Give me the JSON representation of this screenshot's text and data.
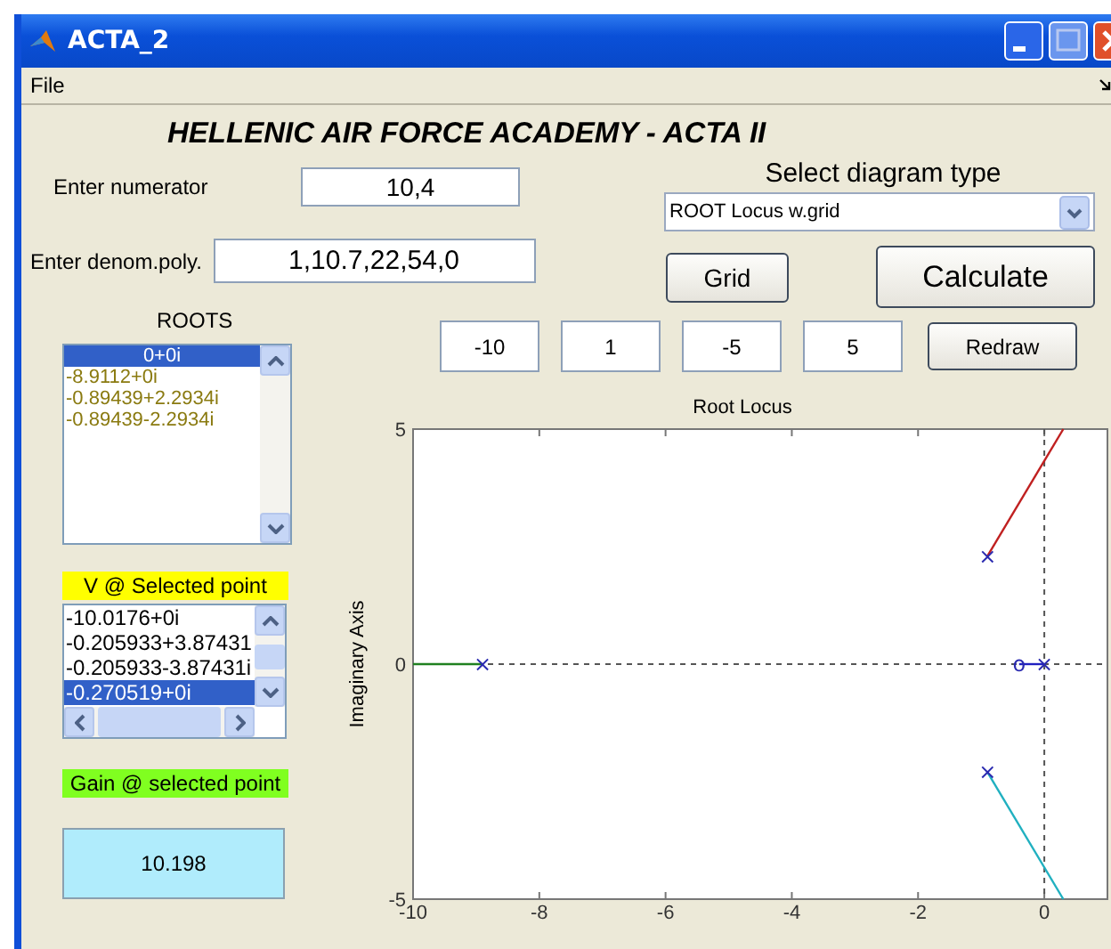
{
  "window": {
    "title": "ACTA_2"
  },
  "menu": [
    "File"
  ],
  "heading": "HELLENIC AIR FORCE ACADEMY - ACTA II",
  "numerator": {
    "label": "Enter numerator",
    "value": "10,4"
  },
  "denominator": {
    "label": "Enter denom.poly.",
    "value": "1,10.7,22,54,0"
  },
  "diagram_type": {
    "label": "Select diagram type",
    "value": "ROOT Locus w.grid"
  },
  "buttons": {
    "grid": "Grid",
    "calculate": "Calculate",
    "redraw": "Redraw"
  },
  "roots": {
    "label": "ROOTS",
    "items": [
      {
        "text": "0+0i",
        "selected": true
      },
      {
        "text": "-8.9112+0i",
        "selected": false
      },
      {
        "text": "-0.89439+2.2934i",
        "selected": false
      },
      {
        "text": "-0.89439-2.2934i",
        "selected": false
      }
    ]
  },
  "selected_point": {
    "label": "V @ Selected point",
    "items": [
      {
        "text": "-10.0176+0i",
        "selected": false
      },
      {
        "text": "-0.205933+3.87431",
        "selected": false
      },
      {
        "text": "-0.205933-3.87431i",
        "selected": false
      },
      {
        "text": "-0.270519+0i",
        "selected": true
      }
    ]
  },
  "gain": {
    "label": "Gain @ selected point",
    "value": "10.198"
  },
  "limits": [
    "-10",
    "1",
    "-5",
    "5"
  ],
  "plot": {
    "chart_data": {
      "type": "line",
      "title": "Root Locus",
      "ylabel": "Imaginary Axis",
      "xlim": [
        -10,
        1
      ],
      "ylim": [
        -5,
        5
      ],
      "xticks": [
        -10,
        -8,
        -6,
        -4,
        -2,
        0
      ],
      "yticks": [
        -5,
        0,
        5
      ],
      "series": [
        {
          "color": "#c02020",
          "x": [
            -0.9,
            0.3
          ],
          "values": [
            2.3,
            5
          ]
        },
        {
          "color": "#20b0c0",
          "x": [
            -0.9,
            0.3
          ],
          "values": [
            -2.3,
            -5
          ]
        },
        {
          "color": "#208020",
          "x": [
            -10,
            -8.9
          ],
          "values": [
            0,
            0
          ]
        },
        {
          "color": "#2020c0",
          "x": [
            -0.4,
            0
          ],
          "values": [
            0,
            0
          ]
        }
      ],
      "annotations": [
        {
          "x": 0,
          "y": 0,
          "text": "×"
        },
        {
          "x": -8.9,
          "y": 0,
          "text": "×"
        },
        {
          "x": -0.9,
          "y": 2.3,
          "text": "×"
        },
        {
          "x": -0.9,
          "y": -2.3,
          "text": "×"
        },
        {
          "x": -0.4,
          "y": 0,
          "text": "o"
        }
      ]
    }
  }
}
